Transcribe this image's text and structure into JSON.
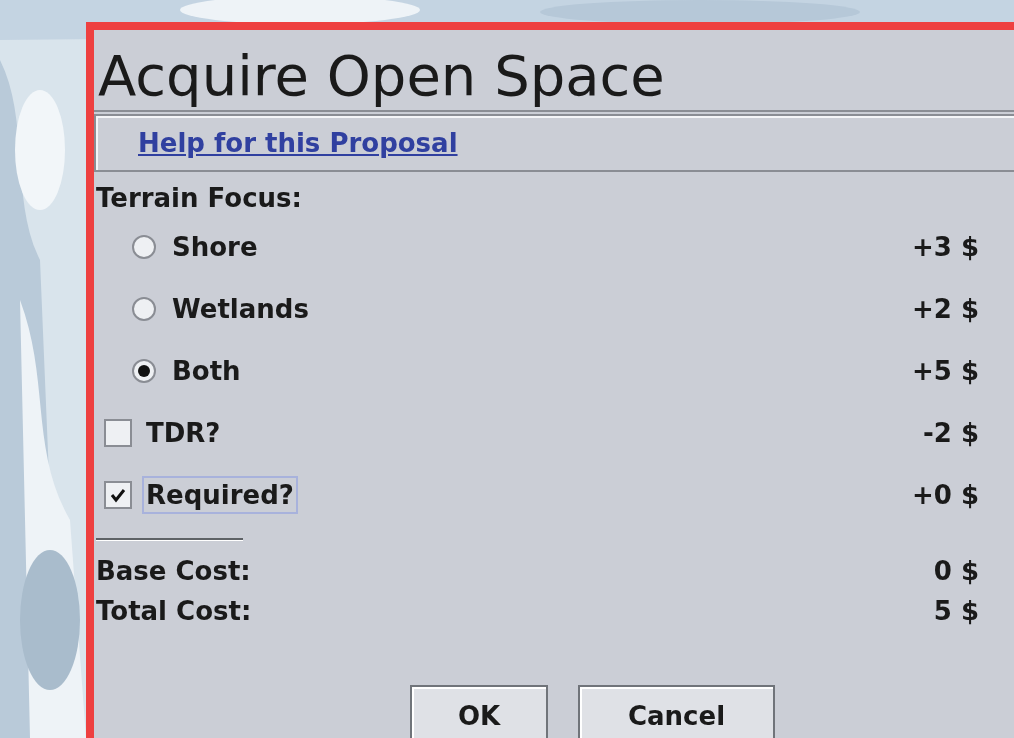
{
  "window": {
    "title": "Acquire Open Space"
  },
  "help_link": "Help for this Proposal",
  "terrain_focus": {
    "label": "Terrain Focus:",
    "options": [
      {
        "label": "Shore",
        "cost": "+3 $",
        "selected": false
      },
      {
        "label": "Wetlands",
        "cost": "+2 $",
        "selected": false
      },
      {
        "label": "Both",
        "cost": "+5 $",
        "selected": true
      }
    ]
  },
  "checkboxes": [
    {
      "label": "TDR?",
      "cost": "-2 $",
      "checked": false,
      "focused": false
    },
    {
      "label": "Required?",
      "cost": "+0 $",
      "checked": true,
      "focused": true
    }
  ],
  "base_cost": {
    "label": "Base Cost:",
    "value": "0 $"
  },
  "total_cost": {
    "label": "Total Cost:",
    "value": "5 $"
  },
  "buttons": [
    "OK",
    "Cancel"
  ]
}
